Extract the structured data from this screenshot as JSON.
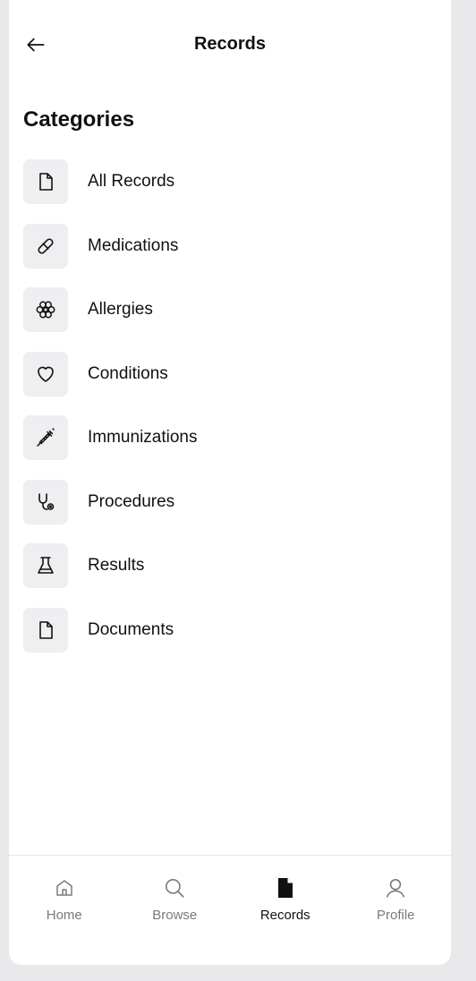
{
  "header": {
    "title": "Records",
    "back_icon": "arrow-left-icon"
  },
  "section": {
    "title": "Categories"
  },
  "categories": [
    {
      "label": "All Records",
      "icon": "file-icon"
    },
    {
      "label": "Medications",
      "icon": "pill-icon"
    },
    {
      "label": "Allergies",
      "icon": "flower-icon"
    },
    {
      "label": "Conditions",
      "icon": "heart-icon"
    },
    {
      "label": "Immunizations",
      "icon": "syringe-icon"
    },
    {
      "label": "Procedures",
      "icon": "stethoscope-icon"
    },
    {
      "label": "Results",
      "icon": "flask-icon"
    },
    {
      "label": "Documents",
      "icon": "file-icon"
    }
  ],
  "tabbar": {
    "tabs": [
      {
        "label": "Home",
        "icon": "home-icon",
        "active": false
      },
      {
        "label": "Browse",
        "icon": "search-icon",
        "active": false
      },
      {
        "label": "Records",
        "icon": "file-filled-icon",
        "active": true
      },
      {
        "label": "Profile",
        "icon": "user-icon",
        "active": false
      }
    ]
  },
  "colors": {
    "background": "#ffffff",
    "icon_box": "#efeff2",
    "text": "#111111",
    "tab_inactive": "#7a7a80",
    "divider": "#e6e6ea"
  }
}
